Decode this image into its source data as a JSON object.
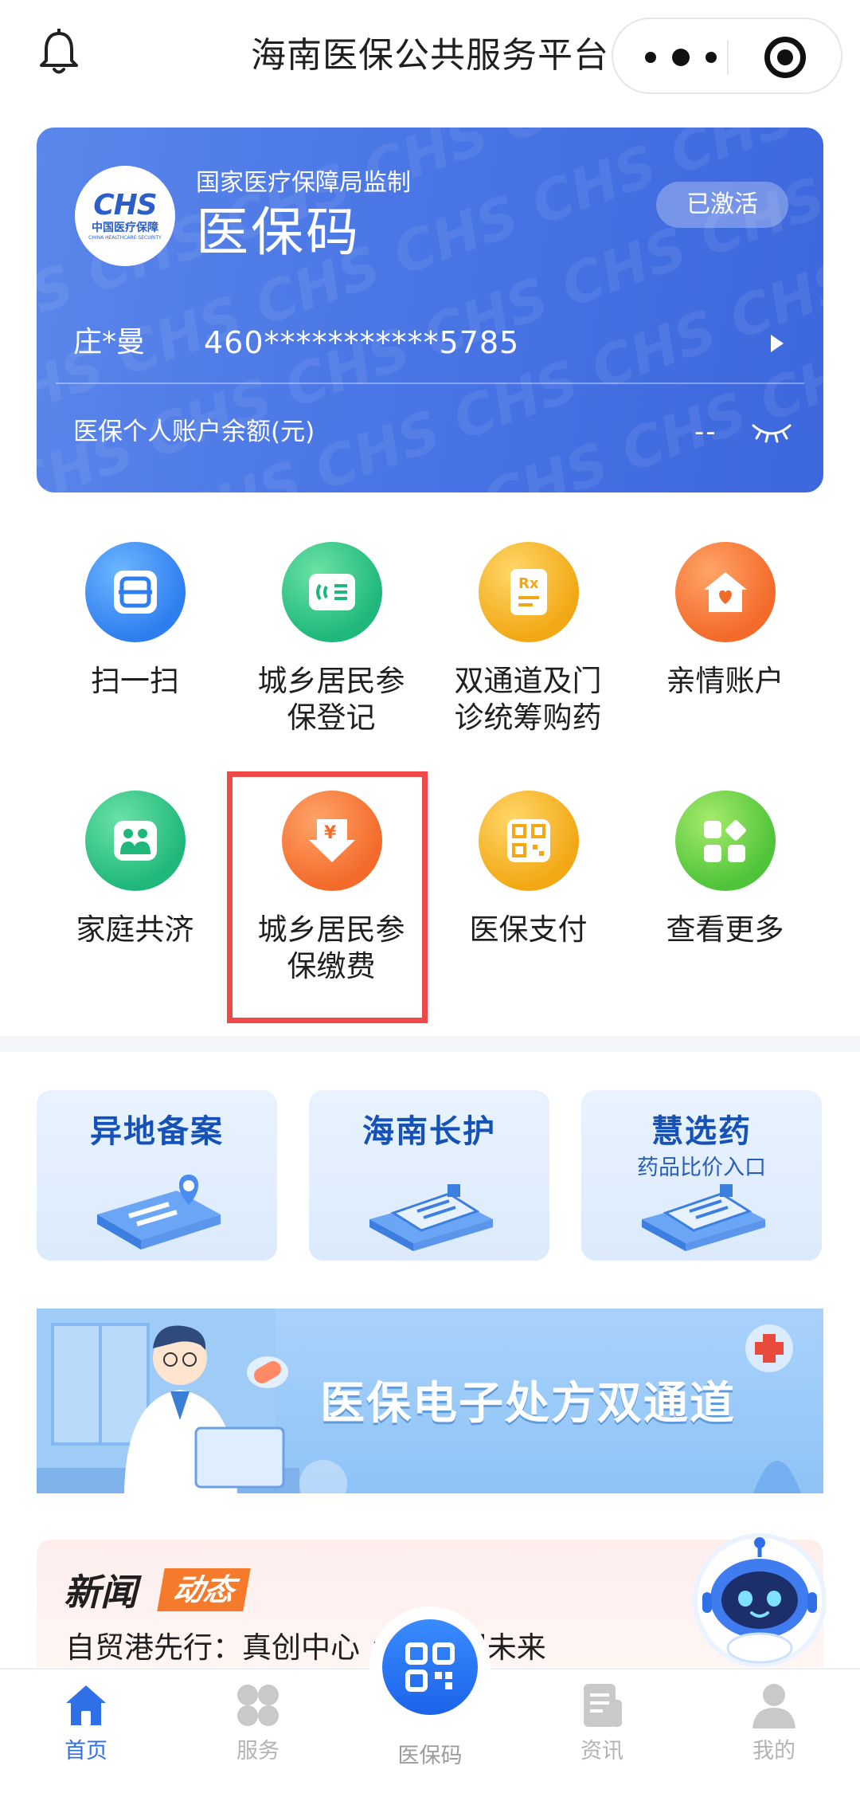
{
  "header": {
    "title": "海南医保公共服务平台"
  },
  "card": {
    "supervise_text": "国家医疗保障局监制",
    "code_name": "医保码",
    "logo_text": "CHS",
    "logo_cn": "中国医疗保障",
    "logo_en": "CHINA HEALTHCARE SECURITY",
    "status": "已激活",
    "name": "庄*曼",
    "id_number": "460***********5785",
    "balance_label": "医保个人账户余额(元)",
    "balance_value": "--"
  },
  "services": [
    {
      "label": "扫一扫",
      "icon": "scan-icon"
    },
    {
      "label": "城乡居民参保登记",
      "icon": "registration-card-icon"
    },
    {
      "label": "双通道及门诊统筹购药",
      "icon": "prescription-icon"
    },
    {
      "label": "亲情账户",
      "icon": "home-heart-icon"
    },
    {
      "label": "家庭共济",
      "icon": "family-icon"
    },
    {
      "label": "城乡居民参保缴费",
      "icon": "yuan-payment-icon"
    },
    {
      "label": "医保支付",
      "icon": "qr-pay-icon"
    },
    {
      "label": "查看更多",
      "icon": "more-apps-icon"
    }
  ],
  "tiles": [
    {
      "title": "异地备案",
      "subtitle": ""
    },
    {
      "title": "海南长护",
      "subtitle": ""
    },
    {
      "title": "慧选药",
      "subtitle": "药品比价入口"
    }
  ],
  "banner": {
    "text": "医保电子处方双通道"
  },
  "news": {
    "title_a": "新闻",
    "title_b": "动态",
    "headline": "自贸港先行：真创中心 点亮医保未来"
  },
  "tabbar": {
    "items": [
      {
        "label": "首页",
        "icon": "home-icon"
      },
      {
        "label": "服务",
        "icon": "services-icon"
      },
      {
        "label": "医保码",
        "icon": "qr-code-icon"
      },
      {
        "label": "资讯",
        "icon": "news-icon"
      },
      {
        "label": "我的",
        "icon": "profile-icon"
      }
    ]
  },
  "colors": {
    "primary": "#2f6fe8",
    "card": "#4a76e6",
    "highlight": "#f0494a"
  }
}
